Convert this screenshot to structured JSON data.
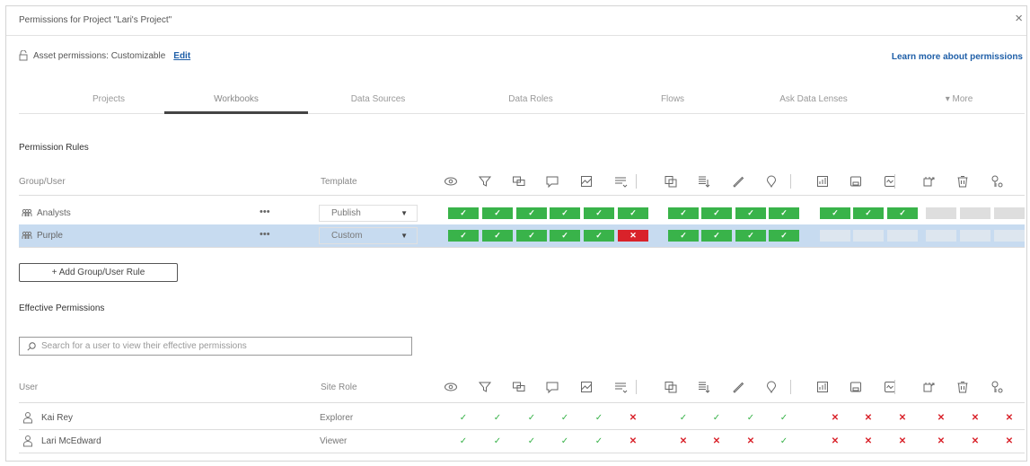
{
  "dialog": {
    "title": "Permissions for Project \"Lari's Project\"",
    "close_glyph": "×",
    "close_icon": "close-icon"
  },
  "asset": {
    "label": "Asset permissions: Customizable",
    "edit": "Edit",
    "lock_icon": "unlock-icon"
  },
  "learn_more": "Learn more about permissions",
  "tabs": [
    {
      "label": "Projects"
    },
    {
      "label": "Workbooks",
      "active": true
    },
    {
      "label": "Data Sources"
    },
    {
      "label": "Data Roles"
    },
    {
      "label": "Flows"
    },
    {
      "label": "Ask Data Lenses"
    },
    {
      "label": "▾ More"
    }
  ],
  "rules": {
    "title": "Permission Rules",
    "col_group": "Group/User",
    "col_template": "Template",
    "capability_icons": [
      "view-icon",
      "filter-icon",
      "comments-view-icon",
      "comment-add-icon",
      "export-image-icon",
      "export-data-icon",
      "view-underlying-data-icon",
      "share-customized-icon",
      "web-edit-icon",
      "explain-data-icon",
      "download-workbook-icon",
      "overwrite-icon",
      "move-icon",
      "delete-icon",
      "set-permissions-icon",
      "run-explain-icon"
    ],
    "rows": [
      {
        "name": "Analysts",
        "dots": "•••",
        "template": "Publish",
        "caret": "▼",
        "selected": false,
        "perms": [
          "allow",
          "allow",
          "allow",
          "allow",
          "allow",
          "allow",
          "allow",
          "allow",
          "allow",
          "allow",
          "allow",
          "allow",
          "allow",
          "none",
          "none",
          "none"
        ]
      },
      {
        "name": "Purple",
        "dots": "•••",
        "template": "Custom",
        "caret": "▼",
        "selected": true,
        "perms": [
          "allow",
          "allow",
          "allow",
          "allow",
          "allow",
          "deny",
          "allow",
          "allow",
          "allow",
          "allow",
          "none",
          "none",
          "none",
          "none",
          "none",
          "none"
        ]
      }
    ],
    "add_button": "+ Add Group/User Rule"
  },
  "effective": {
    "title": "Effective Permissions",
    "search_placeholder": "Search for a user to view their effective permissions",
    "col_user": "User",
    "col_role": "Site Role",
    "users": [
      {
        "name": "Kai Rey",
        "role": "Explorer",
        "perms": [
          "allow",
          "allow",
          "allow",
          "allow",
          "allow",
          "deny",
          "allow",
          "allow",
          "allow",
          "allow",
          "deny",
          "deny",
          "deny",
          "deny",
          "deny",
          "deny"
        ]
      },
      {
        "name": "Lari McEdward",
        "role": "Viewer",
        "perms": [
          "allow",
          "allow",
          "allow",
          "allow",
          "allow",
          "deny",
          "deny",
          "deny",
          "deny",
          "allow",
          "deny",
          "deny",
          "deny",
          "deny",
          "deny",
          "deny"
        ]
      }
    ]
  },
  "colors": {
    "allow": "#39b34a",
    "deny": "#d9222a",
    "link": "#1f5fa8",
    "selected_row": "#c7dbf0"
  }
}
